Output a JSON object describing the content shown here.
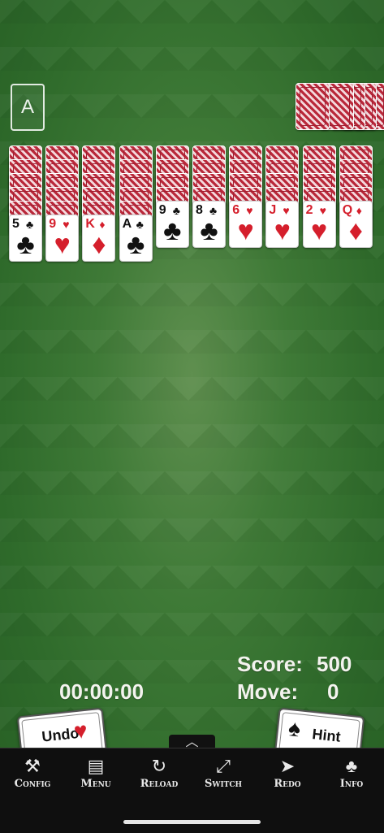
{
  "foundation": {
    "label": "A"
  },
  "score": {
    "label": "Score:",
    "value": "500"
  },
  "moves": {
    "label": "Move:",
    "value": "0"
  },
  "timer": "00:00:00",
  "buttons": {
    "undo": "Undo",
    "hint": "Hint"
  },
  "toolbar": [
    {
      "label": "Config",
      "icon": "wrench-icon",
      "glyph": "⚒"
    },
    {
      "label": "Menu",
      "icon": "document-icon",
      "glyph": "▤"
    },
    {
      "label": "Reload",
      "icon": "reload-icon",
      "glyph": "↻"
    },
    {
      "label": "Switch",
      "icon": "switch-icon",
      "glyph": "⤢"
    },
    {
      "label": "Redo",
      "icon": "redo-icon",
      "glyph": "➤"
    },
    {
      "label": "Info",
      "icon": "info-card-icon",
      "glyph": "♣"
    }
  ],
  "tableau": [
    {
      "rank": "5",
      "suit": "♣",
      "color": "black",
      "hidden": 5
    },
    {
      "rank": "9",
      "suit": "♥",
      "color": "red",
      "hidden": 5
    },
    {
      "rank": "K",
      "suit": "♦",
      "color": "red",
      "hidden": 5
    },
    {
      "rank": "A",
      "suit": "♣",
      "color": "black",
      "hidden": 5
    },
    {
      "rank": "9",
      "suit": "♣",
      "color": "black",
      "hidden": 4
    },
    {
      "rank": "8",
      "suit": "♣",
      "color": "black",
      "hidden": 4
    },
    {
      "rank": "6",
      "suit": "♥",
      "color": "red",
      "hidden": 4
    },
    {
      "rank": "J",
      "suit": "♥",
      "color": "red",
      "hidden": 4
    },
    {
      "rank": "2",
      "suit": "♥",
      "color": "red",
      "hidden": 4
    },
    {
      "rank": "Q",
      "suit": "♦",
      "color": "red",
      "hidden": 4
    }
  ],
  "stock_count": 5,
  "tab_glyph": "︿"
}
